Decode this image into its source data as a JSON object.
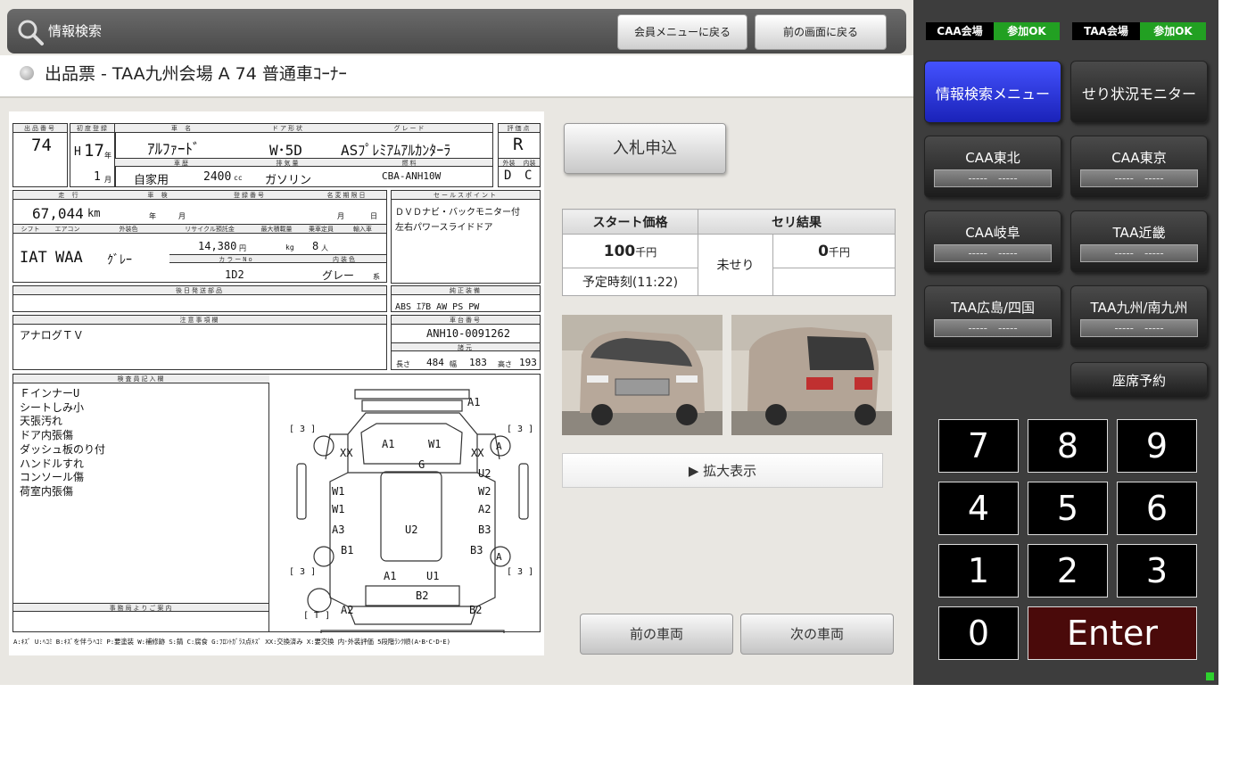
{
  "header": {
    "title": "情報検索",
    "member_menu_label": "会員メニューに戻る",
    "back_label": "前の画面に戻る"
  },
  "subtitle": "出品票 - TAA九州会場 A 74 普通車ｺｰﾅｰ",
  "sheet": {
    "lbl_no": "出品番号",
    "lbl_first_reg": "初度登録",
    "lbl_name": "車 名",
    "lbl_door": "ドア形状",
    "lbl_grade": "グレード",
    "lbl_score": "評価点",
    "lot": "74",
    "year_era": "H",
    "year": "17",
    "year_unit": "年",
    "month": "1",
    "month_unit": "月",
    "name": "ｱﾙﾌｧｰﾄﾞ",
    "door": "W･5D",
    "grade": "ASﾌﾟﾚﾐｱﾑｱﾙｶﾝﾀｰﾗ",
    "score": "R",
    "lbl_history": "車歴",
    "lbl_cc": "排気量",
    "lbl_fuel": "燃料",
    "lbl_model": "型式",
    "lbl_ext": "外装",
    "lbl_int": "内装",
    "history": "自家用",
    "cc": "2400",
    "cc_unit": "cc",
    "fuel": "ガソリン",
    "model": "CBA-ANH10W",
    "ext_score": "D",
    "int_score": "C",
    "lbl_mileage": "走 行",
    "lbl_inspection": "車 検",
    "lbl_plate": "登録番号",
    "lbl_name_change": "名変期限日",
    "lbl_sales": "セールスポイント",
    "mileage": "67,044",
    "mileage_unit": "km",
    "insp_year": "年",
    "insp_month": "月",
    "nc_month": "月",
    "nc_day": "日",
    "sales_1": "ＤＶＤナビ・バックモニター付",
    "sales_2": "左右パワースライドドア",
    "lbl_shift": "シフト",
    "lbl_ac": "エアコン",
    "lbl_color": "外装色",
    "lbl_recycle": "リサイクル預託金",
    "lbl_max_load": "最大積載量",
    "lbl_capacity": "乗車定員",
    "lbl_import": "輸入車",
    "shift": "IAT",
    "ac": "WAA",
    "color": "ｸﾞﾚｰ",
    "recycle": "14,380",
    "recycle_unit": "円",
    "load_unit": "kg",
    "capacity": "8",
    "capacity_unit": "人",
    "lbl_color_no": "カラーNo",
    "lbl_int_color": "内装色",
    "color_no": "1D2",
    "int_color": "グレー",
    "int_color_unit": "系",
    "lbl_later_parts": "後日発送部品",
    "lbl_genuine": "純正装備",
    "genuine": "ABS ｴｱB AW PS PW",
    "lbl_notes": "注意事項欄",
    "notes": "アナログＴＶ",
    "lbl_chassis": "車台番号",
    "chassis": "ANH10-0091262",
    "lbl_dims": "諸元",
    "lbl_length": "長さ",
    "length": "484",
    "lbl_width": "幅",
    "width": "183",
    "lbl_height": "高さ",
    "height": "193",
    "lbl_inspector": "検査員記入欄",
    "inspector_lines": [
      "ＦインナーU",
      "シートしみ小",
      "天張汚れ",
      "ドア内張傷",
      "ダッシュ板のり付",
      "ハンドルすれ",
      "コンソール傷",
      "荷室内張傷"
    ],
    "lbl_office": "事務局よりご案内",
    "legend": "A:ｷｽﾞ U:ﾍｺﾐ B:ｷｽﾞを伴うﾍｺﾐ P:要塗装 W:補修跡 S:錆 C:腐食 G:ﾌﾛﾝﾄｶﾞﾗｽ点ｷｽﾞ XX:交換済み X:要交換 内･外装評価 5段階ﾗﾝｸ順(A･B･C･D･E)",
    "diagram": {
      "a1_top": "A1",
      "a1_left": "A1",
      "w1_top": "W1",
      "xx_left": "XX",
      "xx_right": "XX",
      "g": "G",
      "u2_right": "U2",
      "w1_l1": "W1",
      "w1_l2": "W1",
      "w2": "W2",
      "a2_right": "A2",
      "u2_center": "U2",
      "a3": "A3",
      "b3_right": "B3",
      "b3_lower": "B3",
      "b1": "B1",
      "a1_bottom": "A1",
      "u1": "U1",
      "b2_center": "B2",
      "a2_bottom": "A2",
      "b2_bottom": "B2",
      "bracket3": "[ 3 ]",
      "t": "[ T ]",
      "a_circle": "A"
    }
  },
  "bid_button": "入札申込",
  "price": {
    "h_start": "スタート価格",
    "h_result": "セリ結果",
    "start_value": "100",
    "unit": "千円",
    "result_status": "未せり",
    "result_value": "0",
    "schedule": "予定時刻(11:22)"
  },
  "zoom_label": "▶ 拡大表示",
  "prev_car": "前の車両",
  "next_car": "次の車両",
  "sidebar": {
    "caa_label": "CAA会場",
    "caa_status": "参加OK",
    "taa_label": "TAA会場",
    "taa_status": "参加OK",
    "info_menu": "情報検索メニュー",
    "seri_monitor": "せり状況モニター",
    "venues": [
      {
        "name": "CAA東北",
        "status": "-----　-----"
      },
      {
        "name": "CAA東京",
        "status": "-----　-----"
      },
      {
        "name": "CAA岐阜",
        "status": "-----　-----"
      },
      {
        "name": "TAA近畿",
        "status": "-----　-----"
      },
      {
        "name": "TAA広島/四国",
        "status": "-----　-----"
      },
      {
        "name": "TAA九州/南九州",
        "status": "-----　-----"
      }
    ],
    "seat_reserve": "座席予約",
    "keys": [
      "7",
      "8",
      "9",
      "4",
      "5",
      "6",
      "1",
      "2",
      "3",
      "0"
    ],
    "enter": "Enter",
    "colors": {
      "ok": "#22a022",
      "active": "#2a36e0",
      "enter": "#4a0a0a"
    }
  }
}
